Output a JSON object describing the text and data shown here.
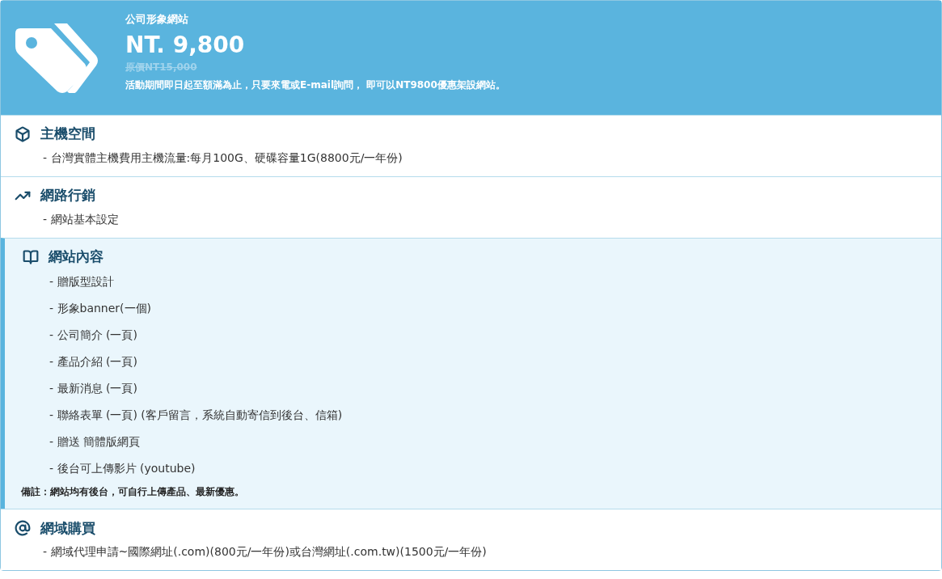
{
  "header": {
    "subtitle": "公司形象網站",
    "price": "NT. 9,800",
    "original_price": "原價NT15,000",
    "description": "活動期間即日起至額滿為止，只要來電或E-mail詢問， 即可以NT9800優惠架設網站。"
  },
  "sections": [
    {
      "kind": "cube",
      "title": "主機空間",
      "highlighted": false,
      "items": [
        "- 台灣實體主機費用主機流量:每月100G、硬碟容量1G(8800元/一年份)"
      ]
    },
    {
      "kind": "chart",
      "title": "網路行銷",
      "highlighted": false,
      "items": [
        "- 網站基本設定"
      ]
    },
    {
      "kind": "book",
      "title": "網站內容",
      "highlighted": true,
      "items": [
        "- 贈版型設計",
        "- 形象banner(一個)",
        "- 公司簡介 (一頁)",
        "- 產品介紹 (一頁)",
        "- 最新消息 (一頁)",
        "- 聯絡表單 (一頁) (客戶留言，系統自動寄信到後台、信箱)",
        "- 贈送 簡體版網頁",
        "- 後台可上傳影片 (youtube)"
      ],
      "note": "備註：網站均有後台，可自行上傳產品、最新優惠。"
    },
    {
      "kind": "at",
      "title": "網域購買",
      "highlighted": false,
      "items": [
        "- 網域代理申請~國際網址(.com)(800元/一年份)或台灣網址(.com.tw)(1500元/一年份)"
      ]
    }
  ]
}
